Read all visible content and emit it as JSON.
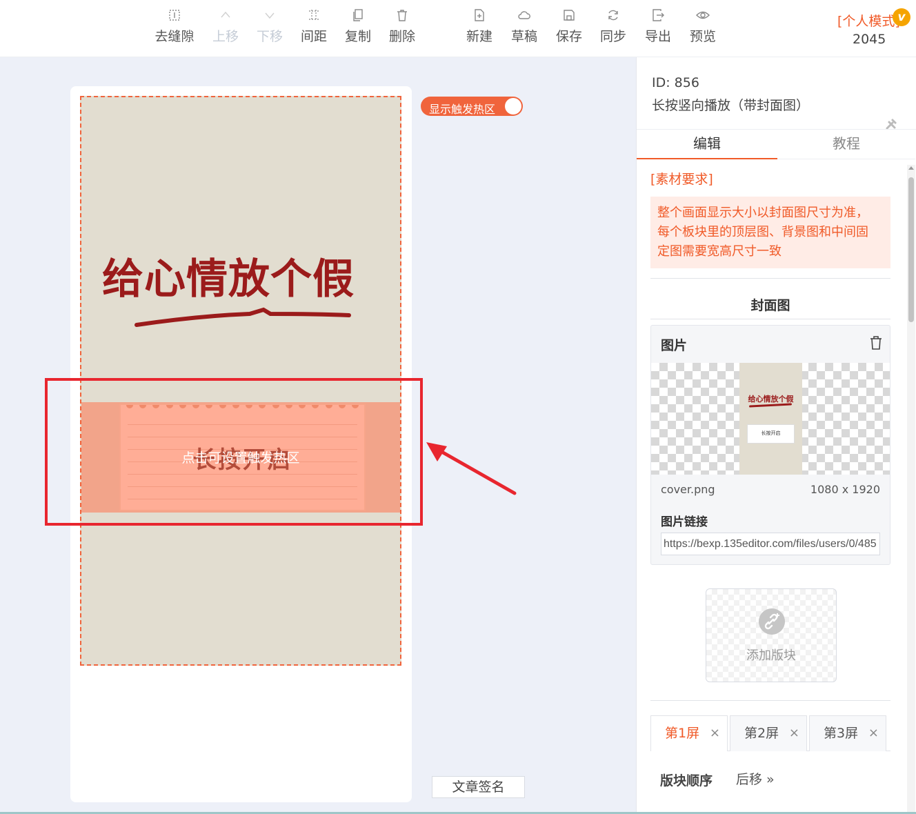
{
  "toolbar": {
    "items": [
      {
        "label": "去缝隙",
        "icon": "grid-gap-icon"
      },
      {
        "label": "上移",
        "icon": "chevron-up-icon"
      },
      {
        "label": "下移",
        "icon": "chevron-down-icon"
      },
      {
        "label": "间距",
        "icon": "spacing-icon"
      },
      {
        "label": "复制",
        "icon": "copy-icon"
      },
      {
        "label": "删除",
        "icon": "trash-icon"
      },
      {
        "label": "新建",
        "icon": "new-file-icon"
      },
      {
        "label": "草稿",
        "icon": "cloud-icon"
      },
      {
        "label": "保存",
        "icon": "save-icon"
      },
      {
        "label": "同步",
        "icon": "sync-icon"
      },
      {
        "label": "导出",
        "icon": "export-icon"
      },
      {
        "label": "预览",
        "icon": "eye-icon"
      }
    ],
    "disabled": [
      "上移",
      "下移"
    ],
    "mode_label": "[个人模式]",
    "mode_badge": "v",
    "mode_number": "2045"
  },
  "canvas": {
    "title_art": "给心情放个假",
    "card_text": "长按开启",
    "hotzone_hint": "点击可设置触发热区",
    "toggle_label": "显示触发热区",
    "toggle_on": true,
    "sign_button": "文章签名",
    "accent": "#f0643c",
    "title_color": "#9b1b1b",
    "highlight_color": "#e8262f"
  },
  "panel": {
    "id_text": "ID: 856",
    "name": "长按竖向播放（带封面图）",
    "tabs": [
      "编辑",
      "教程"
    ],
    "active_tab": "编辑",
    "requirements_title": "[素材要求]",
    "requirements_lines": [
      "整个画面显示大小以封面图尺寸为准，",
      "每个板块里的顶层图、背景图和中间固",
      "定图需要宽高尺寸一致"
    ],
    "cover_section_title": "封面图",
    "image_card": {
      "title": "图片",
      "thumb_title": "给心情放个假",
      "thumb_card_text": "长按开启",
      "filename": "cover.png",
      "dimensions": "1080 x 1920",
      "link_label": "图片链接",
      "link_value": "https://bexp.135editor.com/files/users/0/485"
    },
    "add_block_label": "添加版块",
    "screen_tabs": [
      "第1屏",
      "第2屏",
      "第3屏"
    ],
    "active_screen": "第1屏",
    "close_glyph": "×",
    "order_label": "版块顺序",
    "order_button": "后移 »"
  }
}
